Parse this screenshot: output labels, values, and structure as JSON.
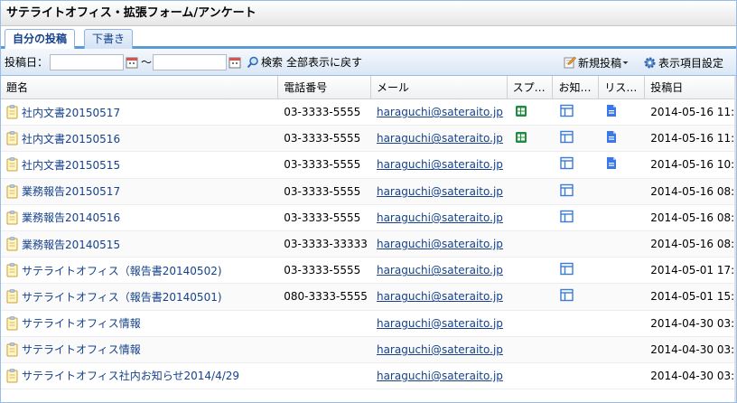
{
  "window": {
    "title": "サテライトオフィス・拡張フォーム/アンケート"
  },
  "tabs": [
    {
      "label": "自分の投稿",
      "active": true
    },
    {
      "label": "下書き",
      "active": false
    }
  ],
  "toolbar": {
    "date_label": "投稿日：",
    "date_from": "",
    "date_to": "",
    "tilde": "～",
    "search_label": "検索",
    "show_all_label": "全部表示に戻す",
    "new_post_label": "新規投稿",
    "columns_label": "表示項目設定"
  },
  "columns": [
    "題名",
    "電話番号",
    "メール",
    "スプ…",
    "お知…",
    "リス…",
    "投稿日"
  ],
  "rows": [
    {
      "title": "社内文書20150517",
      "phone": "03-3333-5555",
      "email": "haraguchi@sateraito.jp",
      "sheet": true,
      "site": true,
      "list": true,
      "date": "2014-05-16 11:"
    },
    {
      "title": "社内文書20150516",
      "phone": "03-3333-5555",
      "email": "haraguchi@sateraito.jp",
      "sheet": true,
      "site": true,
      "list": true,
      "date": "2014-05-16 11:"
    },
    {
      "title": "社内文書20150515",
      "phone": "03-3333-5555",
      "email": "haraguchi@sateraito.jp",
      "sheet": false,
      "site": true,
      "list": true,
      "date": "2014-05-16 10:"
    },
    {
      "title": "業務報告20150517",
      "phone": "03-3333-5555",
      "email": "haraguchi@sateraito.jp",
      "sheet": false,
      "site": true,
      "list": false,
      "date": "2014-05-16 08:"
    },
    {
      "title": "業務報告20140516",
      "phone": "03-3333-5555",
      "email": "haraguchi@sateraito.jp",
      "sheet": false,
      "site": true,
      "list": false,
      "date": "2014-05-16 08:"
    },
    {
      "title": "業務報告20140515",
      "phone": "03-3333-33333",
      "email": "haraguchi@sateraito.jp",
      "sheet": false,
      "site": false,
      "list": false,
      "date": "2014-05-16 08:"
    },
    {
      "title": "サテライトオフィス（報告書20140502)",
      "phone": "03-3333-5555",
      "email": "haraguchi@sateraito.jp",
      "sheet": false,
      "site": true,
      "list": false,
      "date": "2014-05-01 17:"
    },
    {
      "title": "サテライトオフィス（報告書20140501)",
      "phone": "080-3333-5555",
      "email": "haraguchi@sateraito.jp",
      "sheet": false,
      "site": true,
      "list": false,
      "date": "2014-05-01 15:"
    },
    {
      "title": "サテライトオフィス情報",
      "phone": "",
      "email": "haraguchi@sateraito.jp",
      "sheet": false,
      "site": false,
      "list": false,
      "date": "2014-04-30 03:"
    },
    {
      "title": "サテライトオフィス情報",
      "phone": "",
      "email": "haraguchi@sateraito.jp",
      "sheet": false,
      "site": false,
      "list": false,
      "date": "2014-04-30 03:"
    },
    {
      "title": "サテライトオフィス社内お知らせ2014/4/29",
      "phone": "",
      "email": "haraguchi@sateraito.jp",
      "sheet": false,
      "site": false,
      "list": false,
      "date": "2014-04-30 03:"
    }
  ],
  "icons": {
    "row": "document-icon",
    "sheet": "spreadsheet-icon",
    "site": "site-page-icon",
    "list": "list-doc-icon"
  },
  "colors": {
    "accent": "#5b9bd5",
    "link": "#15428b",
    "sheet": "#1e8e3e",
    "list": "#3b78e7"
  }
}
